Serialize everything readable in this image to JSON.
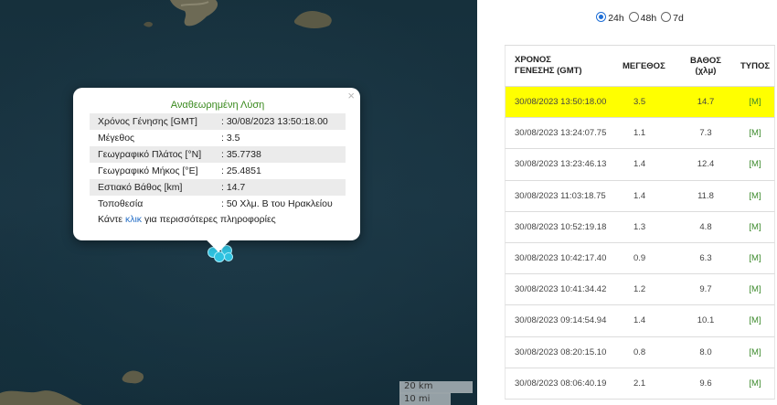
{
  "popup": {
    "title": "Αναθεωρημένη Λύση",
    "close_label": "×",
    "rows": [
      {
        "key": "Χρόνος Γένησης [GMT]",
        "value": ": 30/08/2023 13:50:18.00"
      },
      {
        "key": "Μέγεθος",
        "value": ": 3.5"
      },
      {
        "key": "Γεωγραφικό Πλάτος [°N]",
        "value": ": 35.7738"
      },
      {
        "key": "Γεωγραφικό Μήκος [°E]",
        "value": ": 25.4851"
      },
      {
        "key": "Εστιακό Βάθος [km]",
        "value": ": 14.7"
      },
      {
        "key": "Τοποθεσία",
        "value": ": 50 Χλμ. Β του Ηρακλείου"
      }
    ],
    "more_prefix": "Κάντε ",
    "more_link": "κλικ",
    "more_suffix": " για περισσότερες πληροφορίες"
  },
  "map": {
    "scale_km": "20 km",
    "scale_mi": "10 mi"
  },
  "period": {
    "options": [
      "24h",
      "48h",
      "7d"
    ],
    "selected": "24h"
  },
  "table": {
    "headers": {
      "time_line1": "ΧΡΟΝΟΣ",
      "time_line2": "ΓΕΝΕΣΗΣ (GMT)",
      "magnitude": "ΜΕΓΕΘΟΣ",
      "depth_line1": "ΒΑΘΟΣ",
      "depth_line2": "(χλμ)",
      "type": "ΤΥΠΟΣ"
    },
    "rows": [
      {
        "time": "30/08/2023 13:50:18.00",
        "mag": "3.5",
        "depth": "14.7",
        "type": "[M]"
      },
      {
        "time": "30/08/2023 13:24:07.75",
        "mag": "1.1",
        "depth": "7.3",
        "type": "[M]"
      },
      {
        "time": "30/08/2023 13:23:46.13",
        "mag": "1.4",
        "depth": "12.4",
        "type": "[M]"
      },
      {
        "time": "30/08/2023 11:03:18.75",
        "mag": "1.4",
        "depth": "11.8",
        "type": "[M]"
      },
      {
        "time": "30/08/2023 10:52:19.18",
        "mag": "1.3",
        "depth": "4.8",
        "type": "[M]"
      },
      {
        "time": "30/08/2023 10:42:17.40",
        "mag": "0.9",
        "depth": "6.3",
        "type": "[M]"
      },
      {
        "time": "30/08/2023 10:41:34.42",
        "mag": "1.2",
        "depth": "9.7",
        "type": "[M]"
      },
      {
        "time": "30/08/2023 09:14:54.94",
        "mag": "1.4",
        "depth": "10.1",
        "type": "[M]"
      },
      {
        "time": "30/08/2023 08:20:15.10",
        "mag": "0.8",
        "depth": "8.0",
        "type": "[M]"
      },
      {
        "time": "30/08/2023 08:06:40.19",
        "mag": "2.1",
        "depth": "9.6",
        "type": "[M]"
      }
    ],
    "highlight_color": "#ffff00"
  },
  "colors": {
    "sea": "#1a3543",
    "popup_title": "#3a8a1e",
    "link": "#2a72c8",
    "quake_marker": "#2fc2e0",
    "type_text": "#3c8a2c"
  }
}
